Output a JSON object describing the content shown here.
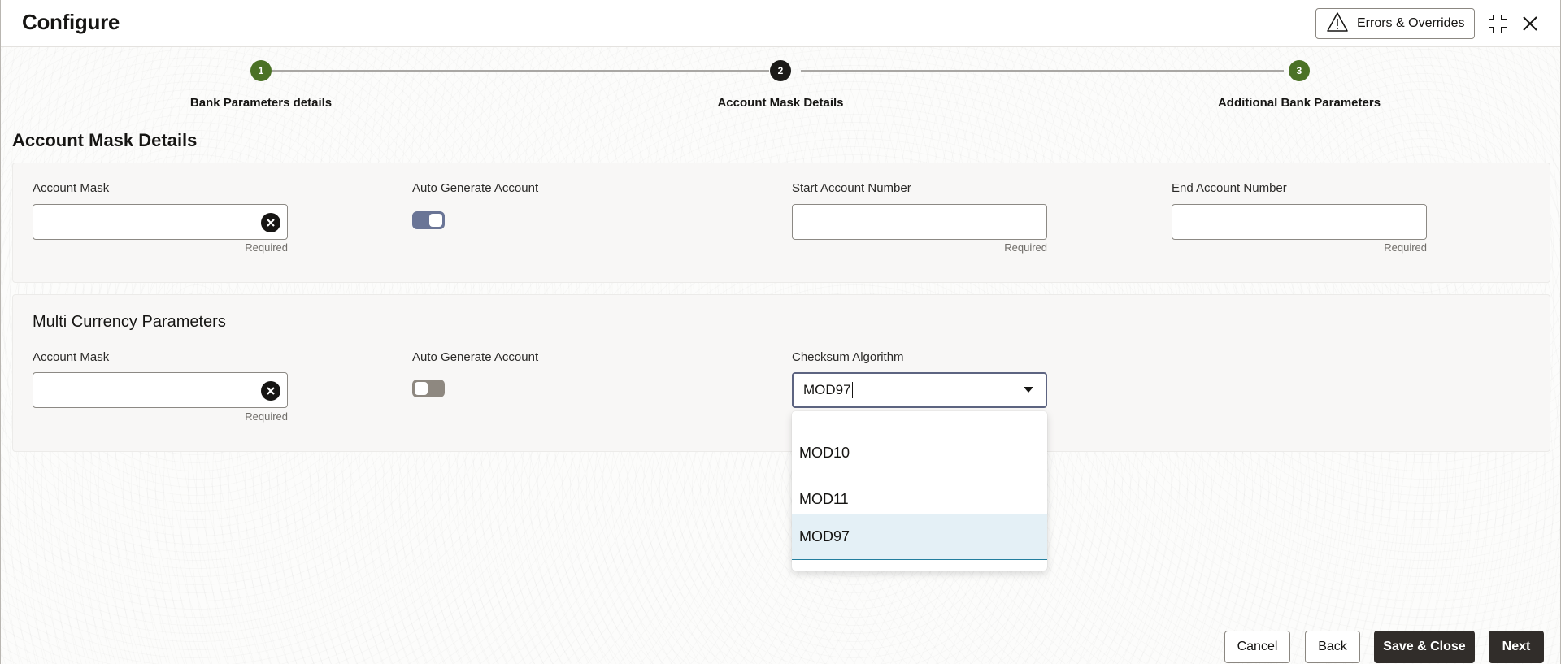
{
  "header": {
    "title": "Configure",
    "errors_button_label": "Errors & Overrides",
    "icons": [
      "warning-icon",
      "collapse-icon",
      "close-icon"
    ]
  },
  "stepper": {
    "steps": [
      {
        "number": "1",
        "label": "Bank Parameters details",
        "state": "done"
      },
      {
        "number": "2",
        "label": "Account Mask Details",
        "state": "current"
      },
      {
        "number": "3",
        "label": "Additional Bank Parameters",
        "state": "done"
      }
    ],
    "colors": {
      "done": "#4b7226",
      "current": "#1b1a18"
    }
  },
  "section": {
    "title": "Account Mask Details"
  },
  "account_mask_panel": {
    "account_mask": {
      "label": "Account Mask",
      "value": "",
      "helper": "Required"
    },
    "auto_generate": {
      "label": "Auto Generate Account",
      "checked": true
    },
    "start_account": {
      "label": "Start Account Number",
      "value": "",
      "helper": "Required"
    },
    "end_account": {
      "label": "End Account Number",
      "value": "",
      "helper": "Required"
    }
  },
  "multi_currency_panel": {
    "title": "Multi Currency Parameters",
    "account_mask": {
      "label": "Account Mask",
      "value": "",
      "helper": "Required"
    },
    "auto_generate": {
      "label": "Auto Generate Account",
      "checked": false
    },
    "checksum": {
      "label": "Checksum Algorithm",
      "value": "MOD97",
      "options": [
        "MOD10",
        "MOD11",
        "MOD97"
      ],
      "selected": "MOD97"
    }
  },
  "footer": {
    "cancel": "Cancel",
    "back": "Back",
    "save_close": "Save & Close",
    "next": "Next"
  }
}
